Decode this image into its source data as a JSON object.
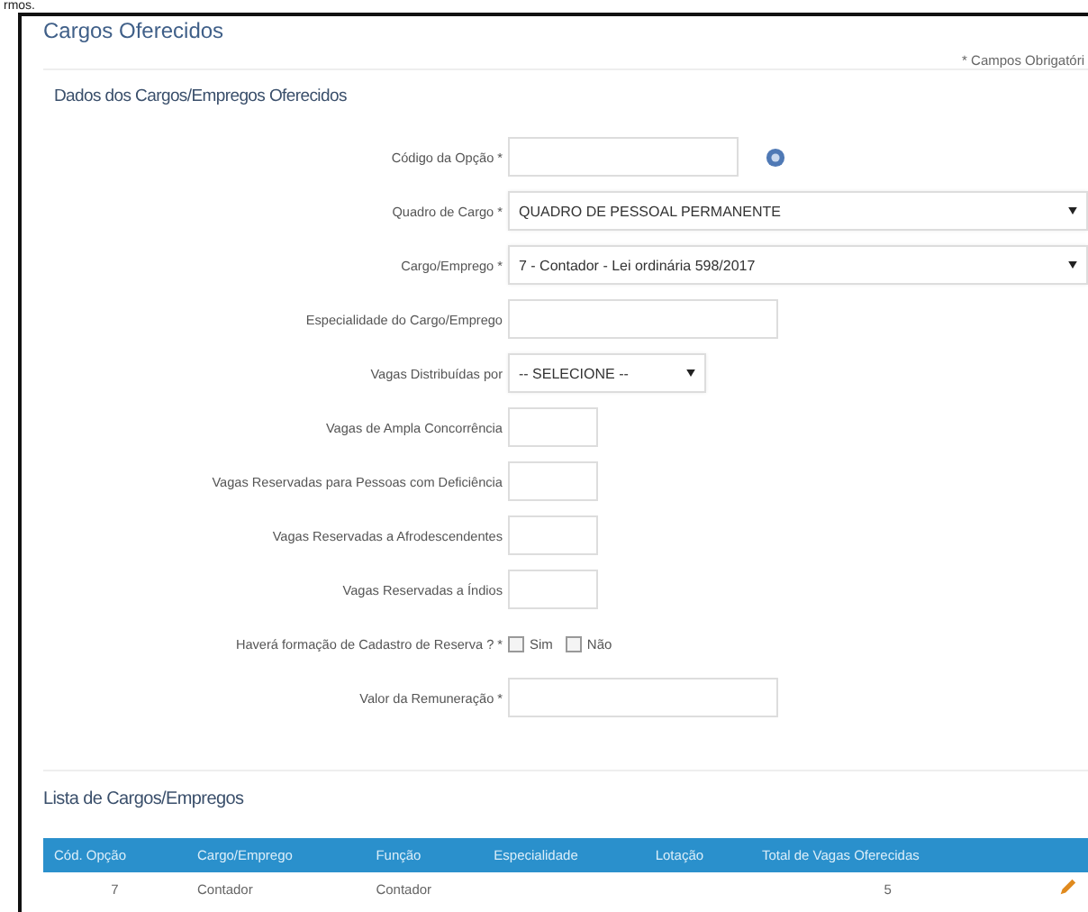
{
  "top_text": "rmos.",
  "title": "Cargos Oferecidos",
  "required_note": "* Campos Obrigatóri",
  "section_title": "Dados dos Cargos/Empregos Oferecidos",
  "fields": [
    {
      "kind": "text",
      "label": "Código da Opção *",
      "help": true
    },
    {
      "kind": "select",
      "label": "Quadro de Cargo *",
      "value": "QUADRO DE PESSOAL PERMANENTE"
    },
    {
      "kind": "select",
      "label": "Cargo/Emprego *",
      "value": "7 - Contador - Lei ordinária 598/2017"
    },
    {
      "kind": "text",
      "label": "Especialidade do Cargo/Emprego"
    },
    {
      "kind": "select",
      "label": "Vagas Distribuídas por",
      "value": "-- SELECIONE --"
    },
    {
      "kind": "text",
      "label": "Vagas de Ampla Concorrência"
    },
    {
      "kind": "text",
      "label": "Vagas Reservadas para Pessoas com Deficiência"
    },
    {
      "kind": "text",
      "label": "Vagas Reservadas a Afrodescendentes"
    },
    {
      "kind": "text",
      "label": "Vagas Reservadas a Índios"
    },
    {
      "kind": "checks",
      "label": "Haverá formação de Cadastro de Reserva ? *",
      "options": [
        {
          "label": "Sim",
          "checked": false
        },
        {
          "label": "Não",
          "checked": false
        }
      ]
    },
    {
      "kind": "text",
      "label": "Valor da Remuneração *"
    }
  ],
  "list_title": "Lista de Cargos/Empregos",
  "table": {
    "columns": [
      "Cód. Opção",
      "Cargo/Emprego",
      "Função",
      "Especialidade",
      "Lotação",
      "Total de Vagas Oferecidas"
    ],
    "rows": [
      {
        "cells": [
          "7",
          "Contador",
          "Contador",
          "",
          "",
          "5"
        ],
        "editable": true
      }
    ]
  }
}
